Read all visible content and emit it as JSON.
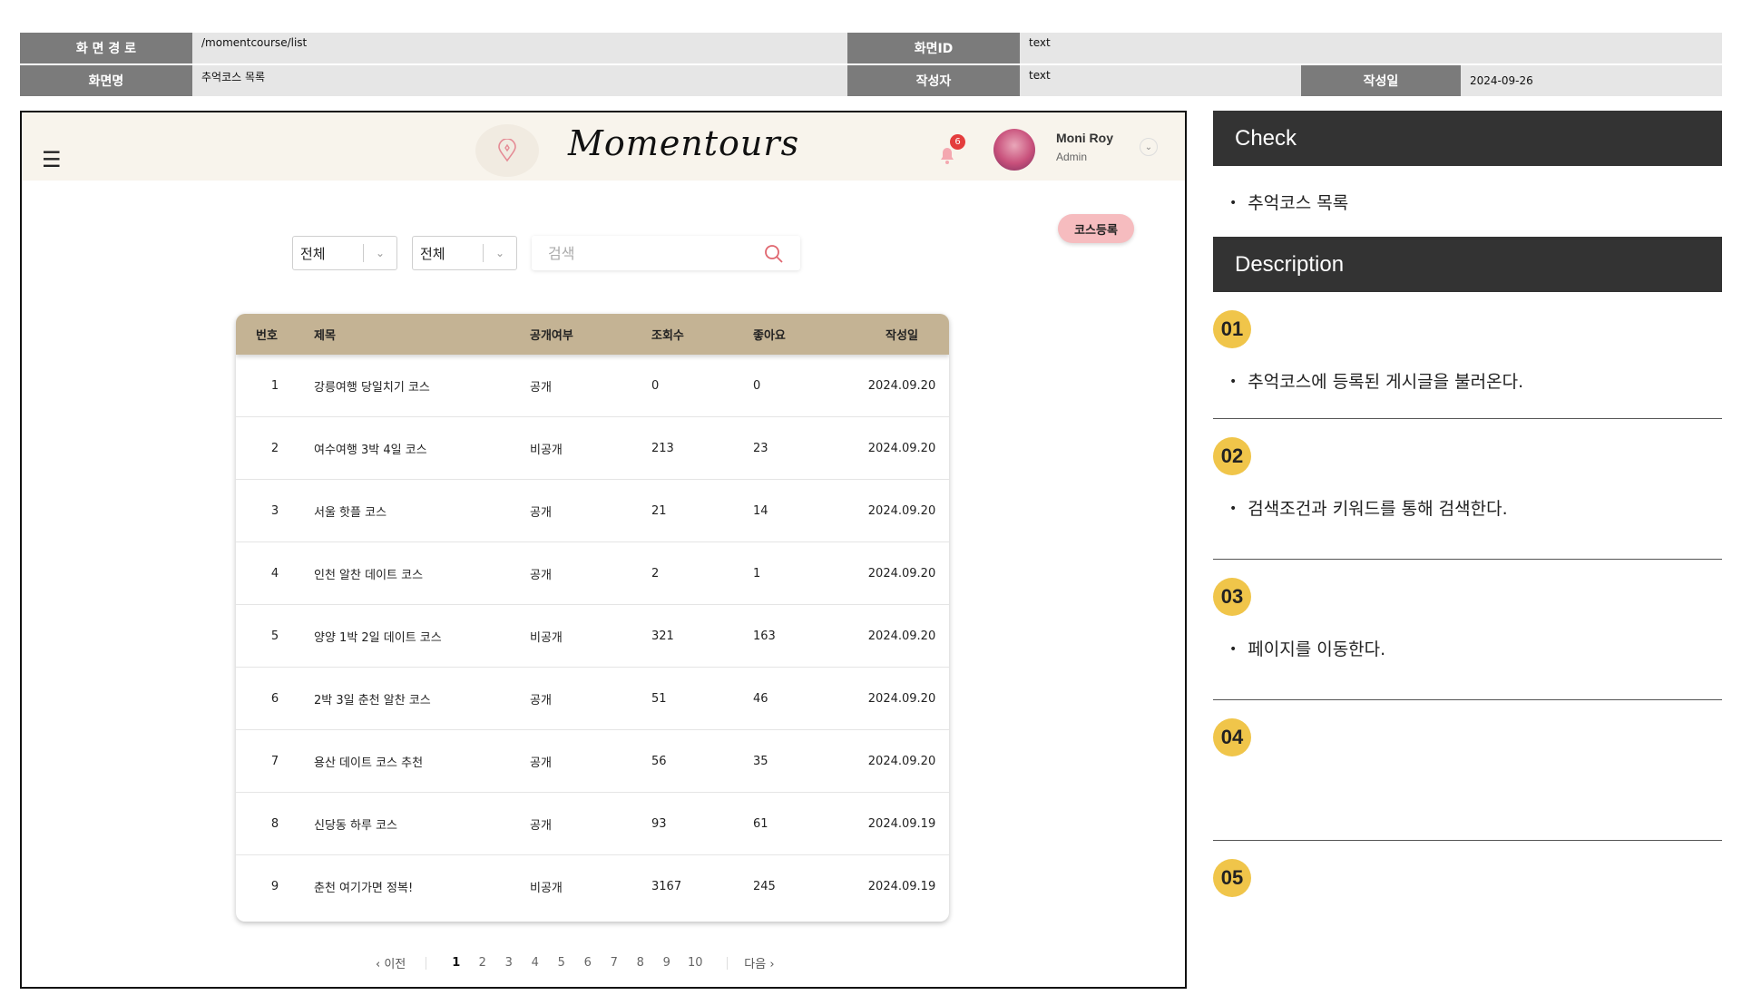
{
  "spec": {
    "path_label": "화 면 경 로",
    "path_value": "/momentcourse/list",
    "id_label": "화면ID",
    "id_value": "text",
    "name_label": "화면명",
    "name_value": "추억코스 목록",
    "author_label": "작성자",
    "author_value": "text",
    "date_label": "작성일",
    "date_value": "2024-09-26"
  },
  "header": {
    "brand": "Momentours",
    "notification_count": "6",
    "user_name": "Moni Roy",
    "user_role": "Admin"
  },
  "toolbar": {
    "register_label": "코스등록",
    "filter1_value": "전체",
    "filter2_value": "전체",
    "search_placeholder": "검색"
  },
  "table": {
    "headers": [
      "번호",
      "제목",
      "공개여부",
      "조회수",
      "좋아요",
      "작성일"
    ],
    "rows": [
      {
        "no": "1",
        "title": "강릉여행 당일치기 코스",
        "public": "공개",
        "views": "0",
        "likes": "0",
        "date": "2024.09.20"
      },
      {
        "no": "2",
        "title": "여수여행 3박 4일 코스",
        "public": "비공개",
        "views": "213",
        "likes": "23",
        "date": "2024.09.20"
      },
      {
        "no": "3",
        "title": "서울 핫플 코스",
        "public": "공개",
        "views": "21",
        "likes": "14",
        "date": "2024.09.20"
      },
      {
        "no": "4",
        "title": "인천 알찬 데이트 코스",
        "public": "공개",
        "views": "2",
        "likes": "1",
        "date": "2024.09.20"
      },
      {
        "no": "5",
        "title": "양양 1박 2일 데이트 코스",
        "public": "비공개",
        "views": "321",
        "likes": "163",
        "date": "2024.09.20"
      },
      {
        "no": "6",
        "title": "2박 3일 춘천 알찬 코스",
        "public": "공개",
        "views": "51",
        "likes": "46",
        "date": "2024.09.20"
      },
      {
        "no": "7",
        "title": "용산 데이트 코스 추천",
        "public": "공개",
        "views": "56",
        "likes": "35",
        "date": "2024.09.20"
      },
      {
        "no": "8",
        "title": "신당동 하루 코스",
        "public": "공개",
        "views": "93",
        "likes": "61",
        "date": "2024.09.19"
      },
      {
        "no": "9",
        "title": "춘천 여기가면 정복!",
        "public": "비공개",
        "views": "3167",
        "likes": "245",
        "date": "2024.09.19"
      }
    ]
  },
  "pagination": {
    "prev": "이전",
    "next": "다음",
    "pages": [
      "1",
      "2",
      "3",
      "4",
      "5",
      "6",
      "7",
      "8",
      "9",
      "10"
    ],
    "current": "1"
  },
  "panel": {
    "check_title": "Check",
    "check_item": "추억코스 목록",
    "description_title": "Description",
    "items": [
      {
        "num": "01",
        "text": "추억코스에 등록된 게시글을 불러온다."
      },
      {
        "num": "02",
        "text": "검색조건과 키워드를 통해 검색한다."
      },
      {
        "num": "03",
        "text": "페이지를 이동한다."
      },
      {
        "num": "04",
        "text": ""
      },
      {
        "num": "05",
        "text": ""
      }
    ]
  },
  "colors": {
    "spec_label_bg": "#7b7b7b",
    "spec_value_bg": "#e6e6e6",
    "topbar_bg": "#f8f4ec",
    "table_header_bg": "#c4b394",
    "register_button_bg": "#f6bcbf",
    "panel_header_bg": "#333333",
    "number_badge_bg": "#f0c54a",
    "notification_badge": "#e43d3d"
  }
}
